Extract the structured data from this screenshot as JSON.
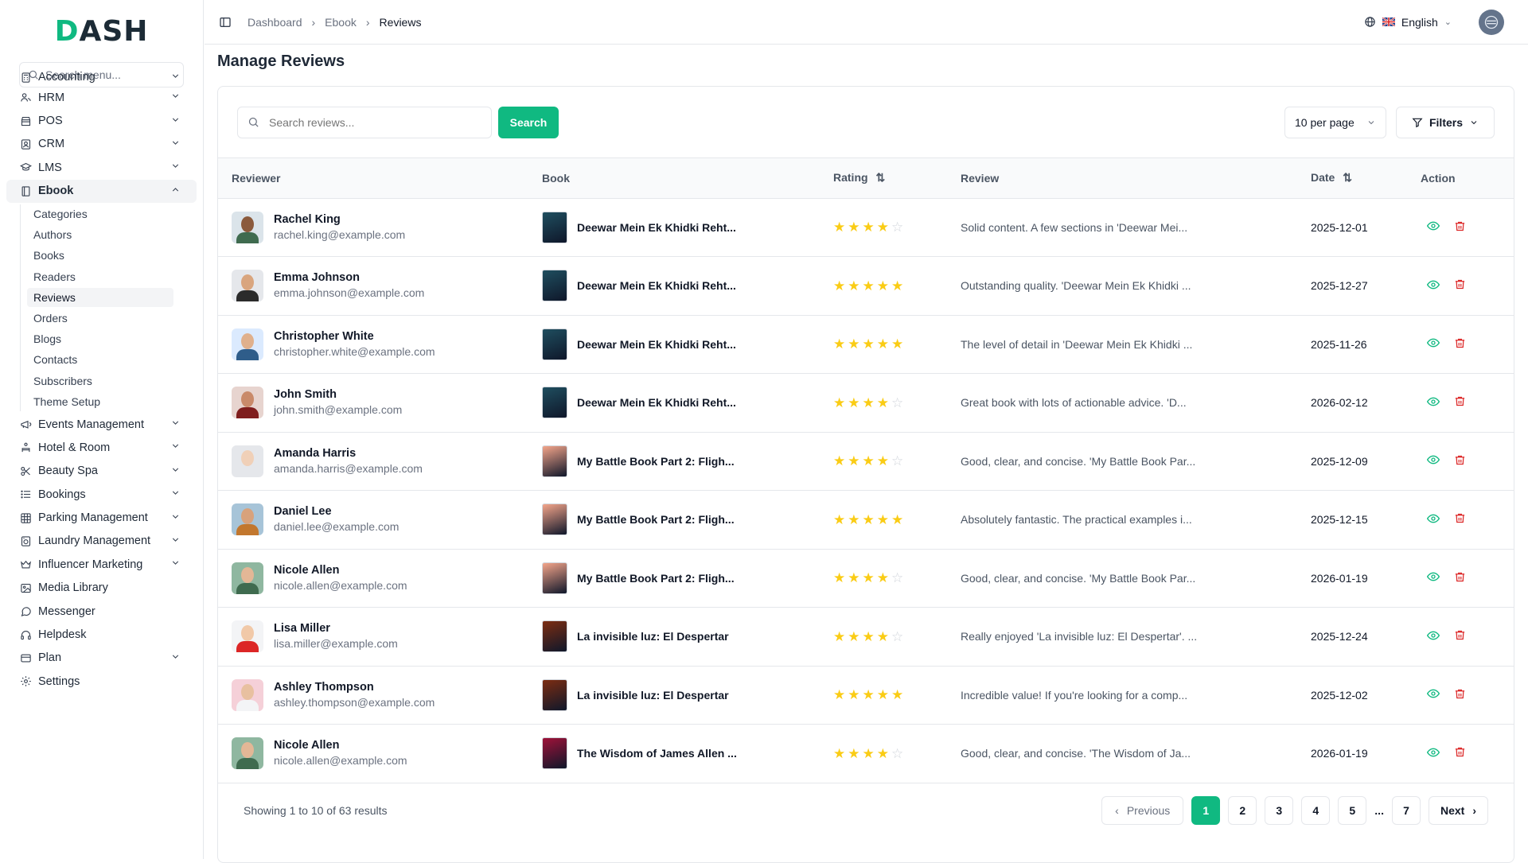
{
  "app": {
    "logo": "DASH"
  },
  "sidebar": {
    "search_placeholder": "Search menu...",
    "items": [
      {
        "label": "Accounting",
        "icon": "calculator-icon",
        "expandable": true
      },
      {
        "label": "HRM",
        "icon": "users-icon",
        "expandable": true
      },
      {
        "label": "POS",
        "icon": "store-icon",
        "expandable": true
      },
      {
        "label": "CRM",
        "icon": "contact-icon",
        "expandable": true
      },
      {
        "label": "LMS",
        "icon": "graduation-cap-icon",
        "expandable": true
      },
      {
        "label": "Ebook",
        "icon": "book-icon",
        "expandable": true,
        "expanded": true
      }
    ],
    "ebook_sub": [
      "Categories",
      "Authors",
      "Books",
      "Readers",
      "Reviews",
      "Orders",
      "Blogs",
      "Contacts",
      "Subscribers",
      "Theme Setup"
    ],
    "ebook_active": "Reviews",
    "items_after": [
      {
        "label": "Events Management",
        "icon": "megaphone-icon",
        "expandable": true
      },
      {
        "label": "Hotel & Room",
        "icon": "hotel-icon",
        "expandable": true
      },
      {
        "label": "Beauty Spa",
        "icon": "scissors-icon",
        "expandable": true
      },
      {
        "label": "Bookings",
        "icon": "list-icon",
        "expandable": true
      },
      {
        "label": "Parking Management",
        "icon": "grid-icon",
        "expandable": true
      },
      {
        "label": "Laundry Management",
        "icon": "washing-machine-icon",
        "expandable": true
      },
      {
        "label": "Influencer Marketing",
        "icon": "crown-icon",
        "expandable": true
      },
      {
        "label": "Media Library",
        "icon": "image-icon",
        "expandable": false
      },
      {
        "label": "Messenger",
        "icon": "chat-icon",
        "expandable": false
      },
      {
        "label": "Helpdesk",
        "icon": "headset-icon",
        "expandable": false
      },
      {
        "label": "Plan",
        "icon": "credit-card-icon",
        "expandable": true
      },
      {
        "label": "Settings",
        "icon": "gear-icon",
        "expandable": false
      }
    ]
  },
  "topbar": {
    "breadcrumbs": [
      "Dashboard",
      "Ebook",
      "Reviews"
    ],
    "language": "English"
  },
  "page": {
    "title": "Manage Reviews",
    "search_placeholder": "Search reviews...",
    "search_button": "Search",
    "per_page": "10 per page",
    "filters": "Filters"
  },
  "table": {
    "columns": [
      "Reviewer",
      "Book",
      "Rating",
      "Review",
      "Date",
      "Action"
    ],
    "rows": [
      {
        "name": "Rachel King",
        "email": "rachel.king@example.com",
        "book": "Deewar Mein Ek Khidki Reht...",
        "rating": 4,
        "review": "Solid content. A few sections in 'Deewar Mei...",
        "date": "2025-12-01",
        "avatar_skin": "#8b5a3c",
        "avatar_shirt": "#3f6b4f",
        "avatar_bg": "#dbe4ea",
        "book_color": "#1f4e5f"
      },
      {
        "name": "Emma Johnson",
        "email": "emma.johnson@example.com",
        "book": "Deewar Mein Ek Khidki Reht...",
        "rating": 5,
        "review": "Outstanding quality. 'Deewar Mein Ek Khidki ...",
        "date": "2025-12-27",
        "avatar_skin": "#d9a57e",
        "avatar_shirt": "#2b2b2b",
        "avatar_bg": "#e5e7eb",
        "book_color": "#1f4e5f"
      },
      {
        "name": "Christopher White",
        "email": "christopher.white@example.com",
        "book": "Deewar Mein Ek Khidki Reht...",
        "rating": 5,
        "review": "The level of detail in 'Deewar Mein Ek Khidki ...",
        "date": "2025-11-26",
        "avatar_skin": "#e0b08c",
        "avatar_shirt": "#2f5d8a",
        "avatar_bg": "#dbeafe",
        "book_color": "#1f4e5f"
      },
      {
        "name": "John Smith",
        "email": "john.smith@example.com",
        "book": "Deewar Mein Ek Khidki Reht...",
        "rating": 4,
        "review": "Great book with lots of actionable advice. 'D...",
        "date": "2026-02-12",
        "avatar_skin": "#c98a6a",
        "avatar_shirt": "#7f1d1d",
        "avatar_bg": "#e7d4cf",
        "book_color": "#1f4e5f"
      },
      {
        "name": "Amanda Harris",
        "email": "amanda.harris@example.com",
        "book": "My Battle Book Part 2: Fligh...",
        "rating": 4,
        "review": "Good, clear, and concise. 'My Battle Book Par...",
        "date": "2025-12-09",
        "avatar_skin": "#f0d0b8",
        "avatar_shirt": "#e5e7eb",
        "avatar_bg": "#e5e7eb",
        "book_color": "#f4a58a"
      },
      {
        "name": "Daniel Lee",
        "email": "daniel.lee@example.com",
        "book": "My Battle Book Part 2: Fligh...",
        "rating": 5,
        "review": "Absolutely fantastic. The practical examples i...",
        "date": "2025-12-15",
        "avatar_skin": "#d8a27c",
        "avatar_shirt": "#c2772e",
        "avatar_bg": "#a7c4d8",
        "book_color": "#f4a58a"
      },
      {
        "name": "Nicole Allen",
        "email": "nicole.allen@example.com",
        "book": "My Battle Book Part 2: Fligh...",
        "rating": 4,
        "review": "Good, clear, and concise. 'My Battle Book Par...",
        "date": "2026-01-19",
        "avatar_skin": "#e3b796",
        "avatar_shirt": "#3f6b4f",
        "avatar_bg": "#8fb7a0",
        "book_color": "#f4a58a"
      },
      {
        "name": "Lisa Miller",
        "email": "lisa.miller@example.com",
        "book": "La invisible luz: El Despertar",
        "rating": 4,
        "review": "Really enjoyed 'La invisible luz: El Despertar'. ...",
        "date": "2025-12-24",
        "avatar_skin": "#f1c9a8",
        "avatar_shirt": "#dc2626",
        "avatar_bg": "#f3f4f6",
        "book_color": "#7c2d12"
      },
      {
        "name": "Ashley Thompson",
        "email": "ashley.thompson@example.com",
        "book": "La invisible luz: El Despertar",
        "rating": 5,
        "review": "Incredible value! If you're looking for a comp...",
        "date": "2025-12-02",
        "avatar_skin": "#e8c0a0",
        "avatar_shirt": "#f3f4f6",
        "avatar_bg": "#f5d0d8",
        "book_color": "#7c2d12"
      },
      {
        "name": "Nicole Allen",
        "email": "nicole.allen@example.com",
        "book": "The Wisdom of James Allen ...",
        "rating": 4,
        "review": "Good, clear, and concise. 'The Wisdom of Ja...",
        "date": "2026-01-19",
        "avatar_skin": "#e3b796",
        "avatar_shirt": "#3f6b4f",
        "avatar_bg": "#8fb7a0",
        "book_color": "#9f1239"
      }
    ]
  },
  "pagination": {
    "showing": "Showing 1 to 10 of 63 results",
    "previous": "Previous",
    "next": "Next",
    "pages": [
      "1",
      "2",
      "3",
      "4",
      "5"
    ],
    "ellipsis": "...",
    "last": "7",
    "current": "1"
  },
  "colors": {
    "accent": "#10b981",
    "star": "#facc15",
    "delete": "#dc2626"
  }
}
